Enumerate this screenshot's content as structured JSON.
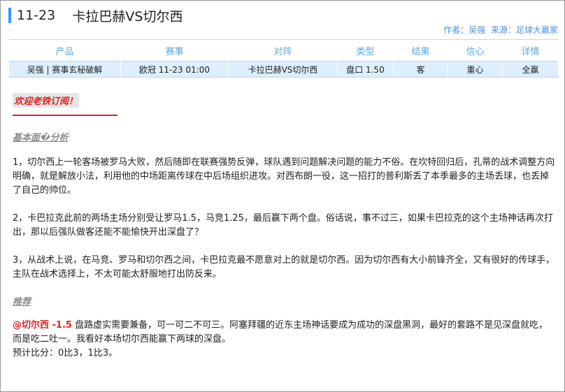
{
  "header": {
    "date": "11-23",
    "match_title": "卡拉巴赫VS切尔西",
    "author": "作者：吴强",
    "source": "来源：足球大赢家"
  },
  "table": {
    "headers": [
      "产品",
      "赛事",
      "对阵",
      "类型",
      "结果",
      "信心",
      "详情"
    ],
    "row": [
      "吴强 | 赛事玄秘破解",
      "欧冠 11-23 01:00",
      "卡拉巴赫VS切尔西",
      "盘口 1.50",
      "客",
      "重心",
      "全赢"
    ]
  },
  "article": {
    "welcome": "欢迎老铁订阅！",
    "section_analysis": "基本面�分析",
    "p1": "1，切尔西上一轮客场被罗马大败，然后随即在联赛强势反弹，球队遇到问题解决问题的能力不俗。在坎特回归后，孔蒂的战术调整方向明确，就是解放小法，利用他的中场距离传球在中后场组织进攻。对西布朗一役，这一招打的普利斯丢了本季最多的主场丢球，也丢掉了自己的帅位。",
    "p2": "2，卡巴拉克此前的两场主场分别受让罗马1.5，马竞1.25，最后赢下两个盘。俗话说，事不过三，如果卡巴拉克的这个主场神话再次打出，那以后强队做客还能不能愉快开出深盘了？",
    "p3": "3，从战术上说，在马竞、罗马和切尔西之间，卡巴拉克最不愿意对上的就是切尔西。因为切尔西有大小前锋齐全，又有很好的传球手，主队在战术选择上，不太可能太舒服地打出防反来。",
    "section_pick": "推荐",
    "pick": "@切尔西 -1.5",
    "pick_text": "  盘路虚实需要兼备，可一可二不可三。阿塞拜疆的近东主场神话要成为成功的深盘黑洞，最好的套路不是见深盘就吃，而是吃二吐一。我看好本场切尔西能赢下两球的深盘。",
    "score": "预计比分：0比3，1比3。"
  },
  "colors": {
    "accent": "#3399ff",
    "header_text": "#5aa7e0",
    "row_bg": "#ddeeff",
    "highlight_red": "#e02020"
  }
}
